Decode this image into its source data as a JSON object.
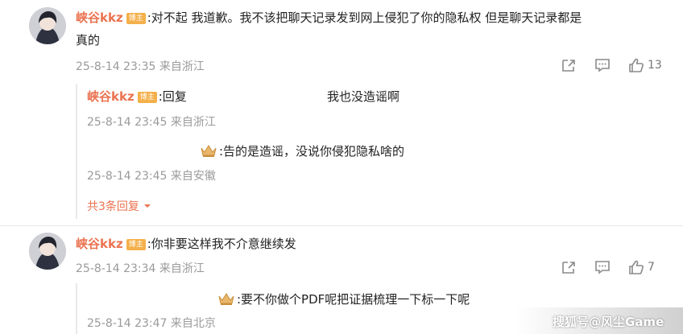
{
  "comments": [
    {
      "username": "峡谷kkz",
      "badge": "博主",
      "text_line1": ":对不起 我道歉。我不该把聊天记录发到网上侵犯了你的隐私权 但是聊天记录都是",
      "text_line2": "真的",
      "meta": "25-8-14 23:35 来自浙江",
      "like_count": "13",
      "replies": [
        {
          "username": "峡谷kkz",
          "badge": "博主",
          "text_prefix": ":回复",
          "text_main": "我也没造谣啊",
          "meta": "25-8-14 23:45 来自浙江"
        },
        {
          "username": "",
          "text": ":告的是造谣，没说你侵犯隐私啥的",
          "meta": "25-8-14 23:45 来自安徽"
        }
      ],
      "more_replies": "共3条回复"
    },
    {
      "username": "峡谷kkz",
      "badge": "博主",
      "text": ":你非要这样我不介意继续发",
      "meta": "25-8-14 23:34 来自浙江",
      "like_count": "7",
      "replies": [
        {
          "username": "",
          "text": ":要不你做个PDF呢把证据梳理一下标一下呢",
          "meta": "25-8-14 23:47 来自北京"
        }
      ]
    }
  ],
  "watermark": "搜狐号@风尘Game",
  "colors": {
    "username": "#eb7350",
    "badge": "#f4b04a",
    "meta": "#9a9a9a"
  },
  "icons": [
    "share-icon",
    "comment-icon",
    "like-icon",
    "crown-icon",
    "chevron-down-icon"
  ]
}
